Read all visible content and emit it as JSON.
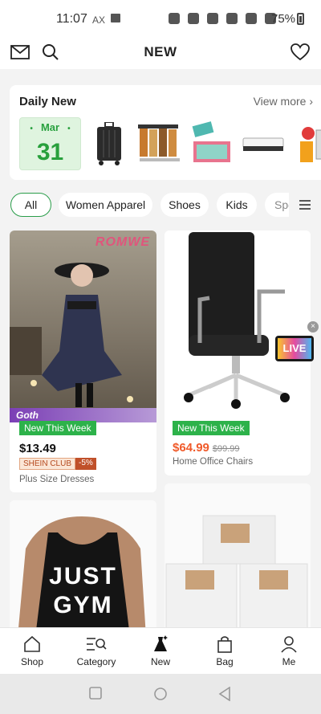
{
  "status": {
    "time": "11:07",
    "ax": "AX",
    "battery": "75%"
  },
  "header": {
    "title": "NEW"
  },
  "daily": {
    "title": "Daily New",
    "view_more": "View more ›",
    "month": "Mar",
    "day": "31"
  },
  "categories": [
    "All",
    "Women Apparel",
    "Shoes",
    "Kids",
    "Spo"
  ],
  "products": [
    {
      "badge": "New This Week",
      "price": "$13.49",
      "club": "SHEIN CLUB",
      "discount": "-5%",
      "name": "Plus Size Dresses",
      "brand": "ROMWE",
      "tag": "Goth"
    },
    {
      "badge": "New This Week",
      "price": "$64.99",
      "old_price": "$99.99",
      "name": "Home Office Chairs",
      "live": "LIVE"
    }
  ],
  "bottom_nav": [
    {
      "label": "Shop"
    },
    {
      "label": "Category"
    },
    {
      "label": "New"
    },
    {
      "label": "Bag"
    },
    {
      "label": "Me"
    }
  ],
  "colors": {
    "accent_green": "#2db24a",
    "price_orange": "#f05a2a",
    "club_brown": "#c0502a"
  }
}
